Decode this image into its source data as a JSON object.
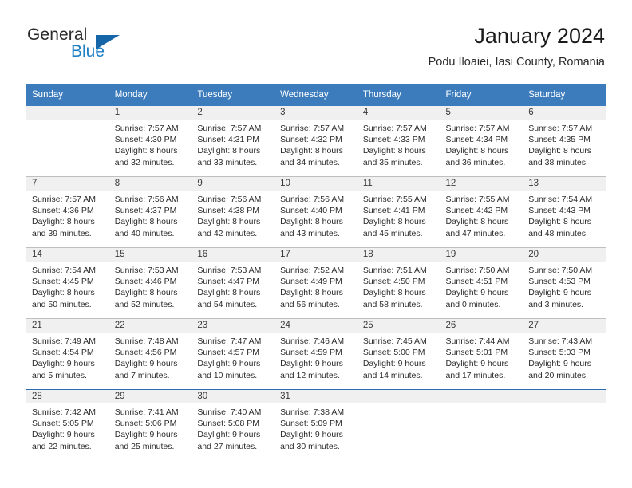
{
  "brand": {
    "name_part1": "General",
    "name_part2": "Blue",
    "accent_color": "#1f7fc4",
    "triangle_color": "#1565a8"
  },
  "header": {
    "title": "January 2024",
    "subtitle": "Podu Iloaiei, Iasi County, Romania"
  },
  "calendar": {
    "header_bg": "#3c7cbc",
    "daynum_band_bg": "#f0f0f0",
    "weekday_headers": [
      "Sunday",
      "Monday",
      "Tuesday",
      "Wednesday",
      "Thursday",
      "Friday",
      "Saturday"
    ],
    "weeks": [
      [
        {
          "day": "",
          "empty": true,
          "sunrise": "",
          "sunset": "",
          "daylight_line1": "",
          "daylight_line2": ""
        },
        {
          "day": "1",
          "empty": false,
          "sunrise": "Sunrise: 7:57 AM",
          "sunset": "Sunset: 4:30 PM",
          "daylight_line1": "Daylight: 8 hours",
          "daylight_line2": "and 32 minutes."
        },
        {
          "day": "2",
          "empty": false,
          "sunrise": "Sunrise: 7:57 AM",
          "sunset": "Sunset: 4:31 PM",
          "daylight_line1": "Daylight: 8 hours",
          "daylight_line2": "and 33 minutes."
        },
        {
          "day": "3",
          "empty": false,
          "sunrise": "Sunrise: 7:57 AM",
          "sunset": "Sunset: 4:32 PM",
          "daylight_line1": "Daylight: 8 hours",
          "daylight_line2": "and 34 minutes."
        },
        {
          "day": "4",
          "empty": false,
          "sunrise": "Sunrise: 7:57 AM",
          "sunset": "Sunset: 4:33 PM",
          "daylight_line1": "Daylight: 8 hours",
          "daylight_line2": "and 35 minutes."
        },
        {
          "day": "5",
          "empty": false,
          "sunrise": "Sunrise: 7:57 AM",
          "sunset": "Sunset: 4:34 PM",
          "daylight_line1": "Daylight: 8 hours",
          "daylight_line2": "and 36 minutes."
        },
        {
          "day": "6",
          "empty": false,
          "sunrise": "Sunrise: 7:57 AM",
          "sunset": "Sunset: 4:35 PM",
          "daylight_line1": "Daylight: 8 hours",
          "daylight_line2": "and 38 minutes."
        }
      ],
      [
        {
          "day": "7",
          "empty": false,
          "sunrise": "Sunrise: 7:57 AM",
          "sunset": "Sunset: 4:36 PM",
          "daylight_line1": "Daylight: 8 hours",
          "daylight_line2": "and 39 minutes."
        },
        {
          "day": "8",
          "empty": false,
          "sunrise": "Sunrise: 7:56 AM",
          "sunset": "Sunset: 4:37 PM",
          "daylight_line1": "Daylight: 8 hours",
          "daylight_line2": "and 40 minutes."
        },
        {
          "day": "9",
          "empty": false,
          "sunrise": "Sunrise: 7:56 AM",
          "sunset": "Sunset: 4:38 PM",
          "daylight_line1": "Daylight: 8 hours",
          "daylight_line2": "and 42 minutes."
        },
        {
          "day": "10",
          "empty": false,
          "sunrise": "Sunrise: 7:56 AM",
          "sunset": "Sunset: 4:40 PM",
          "daylight_line1": "Daylight: 8 hours",
          "daylight_line2": "and 43 minutes."
        },
        {
          "day": "11",
          "empty": false,
          "sunrise": "Sunrise: 7:55 AM",
          "sunset": "Sunset: 4:41 PM",
          "daylight_line1": "Daylight: 8 hours",
          "daylight_line2": "and 45 minutes."
        },
        {
          "day": "12",
          "empty": false,
          "sunrise": "Sunrise: 7:55 AM",
          "sunset": "Sunset: 4:42 PM",
          "daylight_line1": "Daylight: 8 hours",
          "daylight_line2": "and 47 minutes."
        },
        {
          "day": "13",
          "empty": false,
          "sunrise": "Sunrise: 7:54 AM",
          "sunset": "Sunset: 4:43 PM",
          "daylight_line1": "Daylight: 8 hours",
          "daylight_line2": "and 48 minutes."
        }
      ],
      [
        {
          "day": "14",
          "empty": false,
          "sunrise": "Sunrise: 7:54 AM",
          "sunset": "Sunset: 4:45 PM",
          "daylight_line1": "Daylight: 8 hours",
          "daylight_line2": "and 50 minutes."
        },
        {
          "day": "15",
          "empty": false,
          "sunrise": "Sunrise: 7:53 AM",
          "sunset": "Sunset: 4:46 PM",
          "daylight_line1": "Daylight: 8 hours",
          "daylight_line2": "and 52 minutes."
        },
        {
          "day": "16",
          "empty": false,
          "sunrise": "Sunrise: 7:53 AM",
          "sunset": "Sunset: 4:47 PM",
          "daylight_line1": "Daylight: 8 hours",
          "daylight_line2": "and 54 minutes."
        },
        {
          "day": "17",
          "empty": false,
          "sunrise": "Sunrise: 7:52 AM",
          "sunset": "Sunset: 4:49 PM",
          "daylight_line1": "Daylight: 8 hours",
          "daylight_line2": "and 56 minutes."
        },
        {
          "day": "18",
          "empty": false,
          "sunrise": "Sunrise: 7:51 AM",
          "sunset": "Sunset: 4:50 PM",
          "daylight_line1": "Daylight: 8 hours",
          "daylight_line2": "and 58 minutes."
        },
        {
          "day": "19",
          "empty": false,
          "sunrise": "Sunrise: 7:50 AM",
          "sunset": "Sunset: 4:51 PM",
          "daylight_line1": "Daylight: 9 hours",
          "daylight_line2": "and 0 minutes."
        },
        {
          "day": "20",
          "empty": false,
          "sunrise": "Sunrise: 7:50 AM",
          "sunset": "Sunset: 4:53 PM",
          "daylight_line1": "Daylight: 9 hours",
          "daylight_line2": "and 3 minutes."
        }
      ],
      [
        {
          "day": "21",
          "empty": false,
          "sunrise": "Sunrise: 7:49 AM",
          "sunset": "Sunset: 4:54 PM",
          "daylight_line1": "Daylight: 9 hours",
          "daylight_line2": "and 5 minutes."
        },
        {
          "day": "22",
          "empty": false,
          "sunrise": "Sunrise: 7:48 AM",
          "sunset": "Sunset: 4:56 PM",
          "daylight_line1": "Daylight: 9 hours",
          "daylight_line2": "and 7 minutes."
        },
        {
          "day": "23",
          "empty": false,
          "sunrise": "Sunrise: 7:47 AM",
          "sunset": "Sunset: 4:57 PM",
          "daylight_line1": "Daylight: 9 hours",
          "daylight_line2": "and 10 minutes."
        },
        {
          "day": "24",
          "empty": false,
          "sunrise": "Sunrise: 7:46 AM",
          "sunset": "Sunset: 4:59 PM",
          "daylight_line1": "Daylight: 9 hours",
          "daylight_line2": "and 12 minutes."
        },
        {
          "day": "25",
          "empty": false,
          "sunrise": "Sunrise: 7:45 AM",
          "sunset": "Sunset: 5:00 PM",
          "daylight_line1": "Daylight: 9 hours",
          "daylight_line2": "and 14 minutes."
        },
        {
          "day": "26",
          "empty": false,
          "sunrise": "Sunrise: 7:44 AM",
          "sunset": "Sunset: 5:01 PM",
          "daylight_line1": "Daylight: 9 hours",
          "daylight_line2": "and 17 minutes."
        },
        {
          "day": "27",
          "empty": false,
          "sunrise": "Sunrise: 7:43 AM",
          "sunset": "Sunset: 5:03 PM",
          "daylight_line1": "Daylight: 9 hours",
          "daylight_line2": "and 20 minutes."
        }
      ],
      [
        {
          "day": "28",
          "empty": false,
          "sunrise": "Sunrise: 7:42 AM",
          "sunset": "Sunset: 5:05 PM",
          "daylight_line1": "Daylight: 9 hours",
          "daylight_line2": "and 22 minutes."
        },
        {
          "day": "29",
          "empty": false,
          "sunrise": "Sunrise: 7:41 AM",
          "sunset": "Sunset: 5:06 PM",
          "daylight_line1": "Daylight: 9 hours",
          "daylight_line2": "and 25 minutes."
        },
        {
          "day": "30",
          "empty": false,
          "sunrise": "Sunrise: 7:40 AM",
          "sunset": "Sunset: 5:08 PM",
          "daylight_line1": "Daylight: 9 hours",
          "daylight_line2": "and 27 minutes."
        },
        {
          "day": "31",
          "empty": false,
          "sunrise": "Sunrise: 7:38 AM",
          "sunset": "Sunset: 5:09 PM",
          "daylight_line1": "Daylight: 9 hours",
          "daylight_line2": "and 30 minutes."
        },
        {
          "day": "",
          "empty": true,
          "sunrise": "",
          "sunset": "",
          "daylight_line1": "",
          "daylight_line2": ""
        },
        {
          "day": "",
          "empty": true,
          "sunrise": "",
          "sunset": "",
          "daylight_line1": "",
          "daylight_line2": ""
        },
        {
          "day": "",
          "empty": true,
          "sunrise": "",
          "sunset": "",
          "daylight_line1": "",
          "daylight_line2": ""
        }
      ]
    ]
  }
}
